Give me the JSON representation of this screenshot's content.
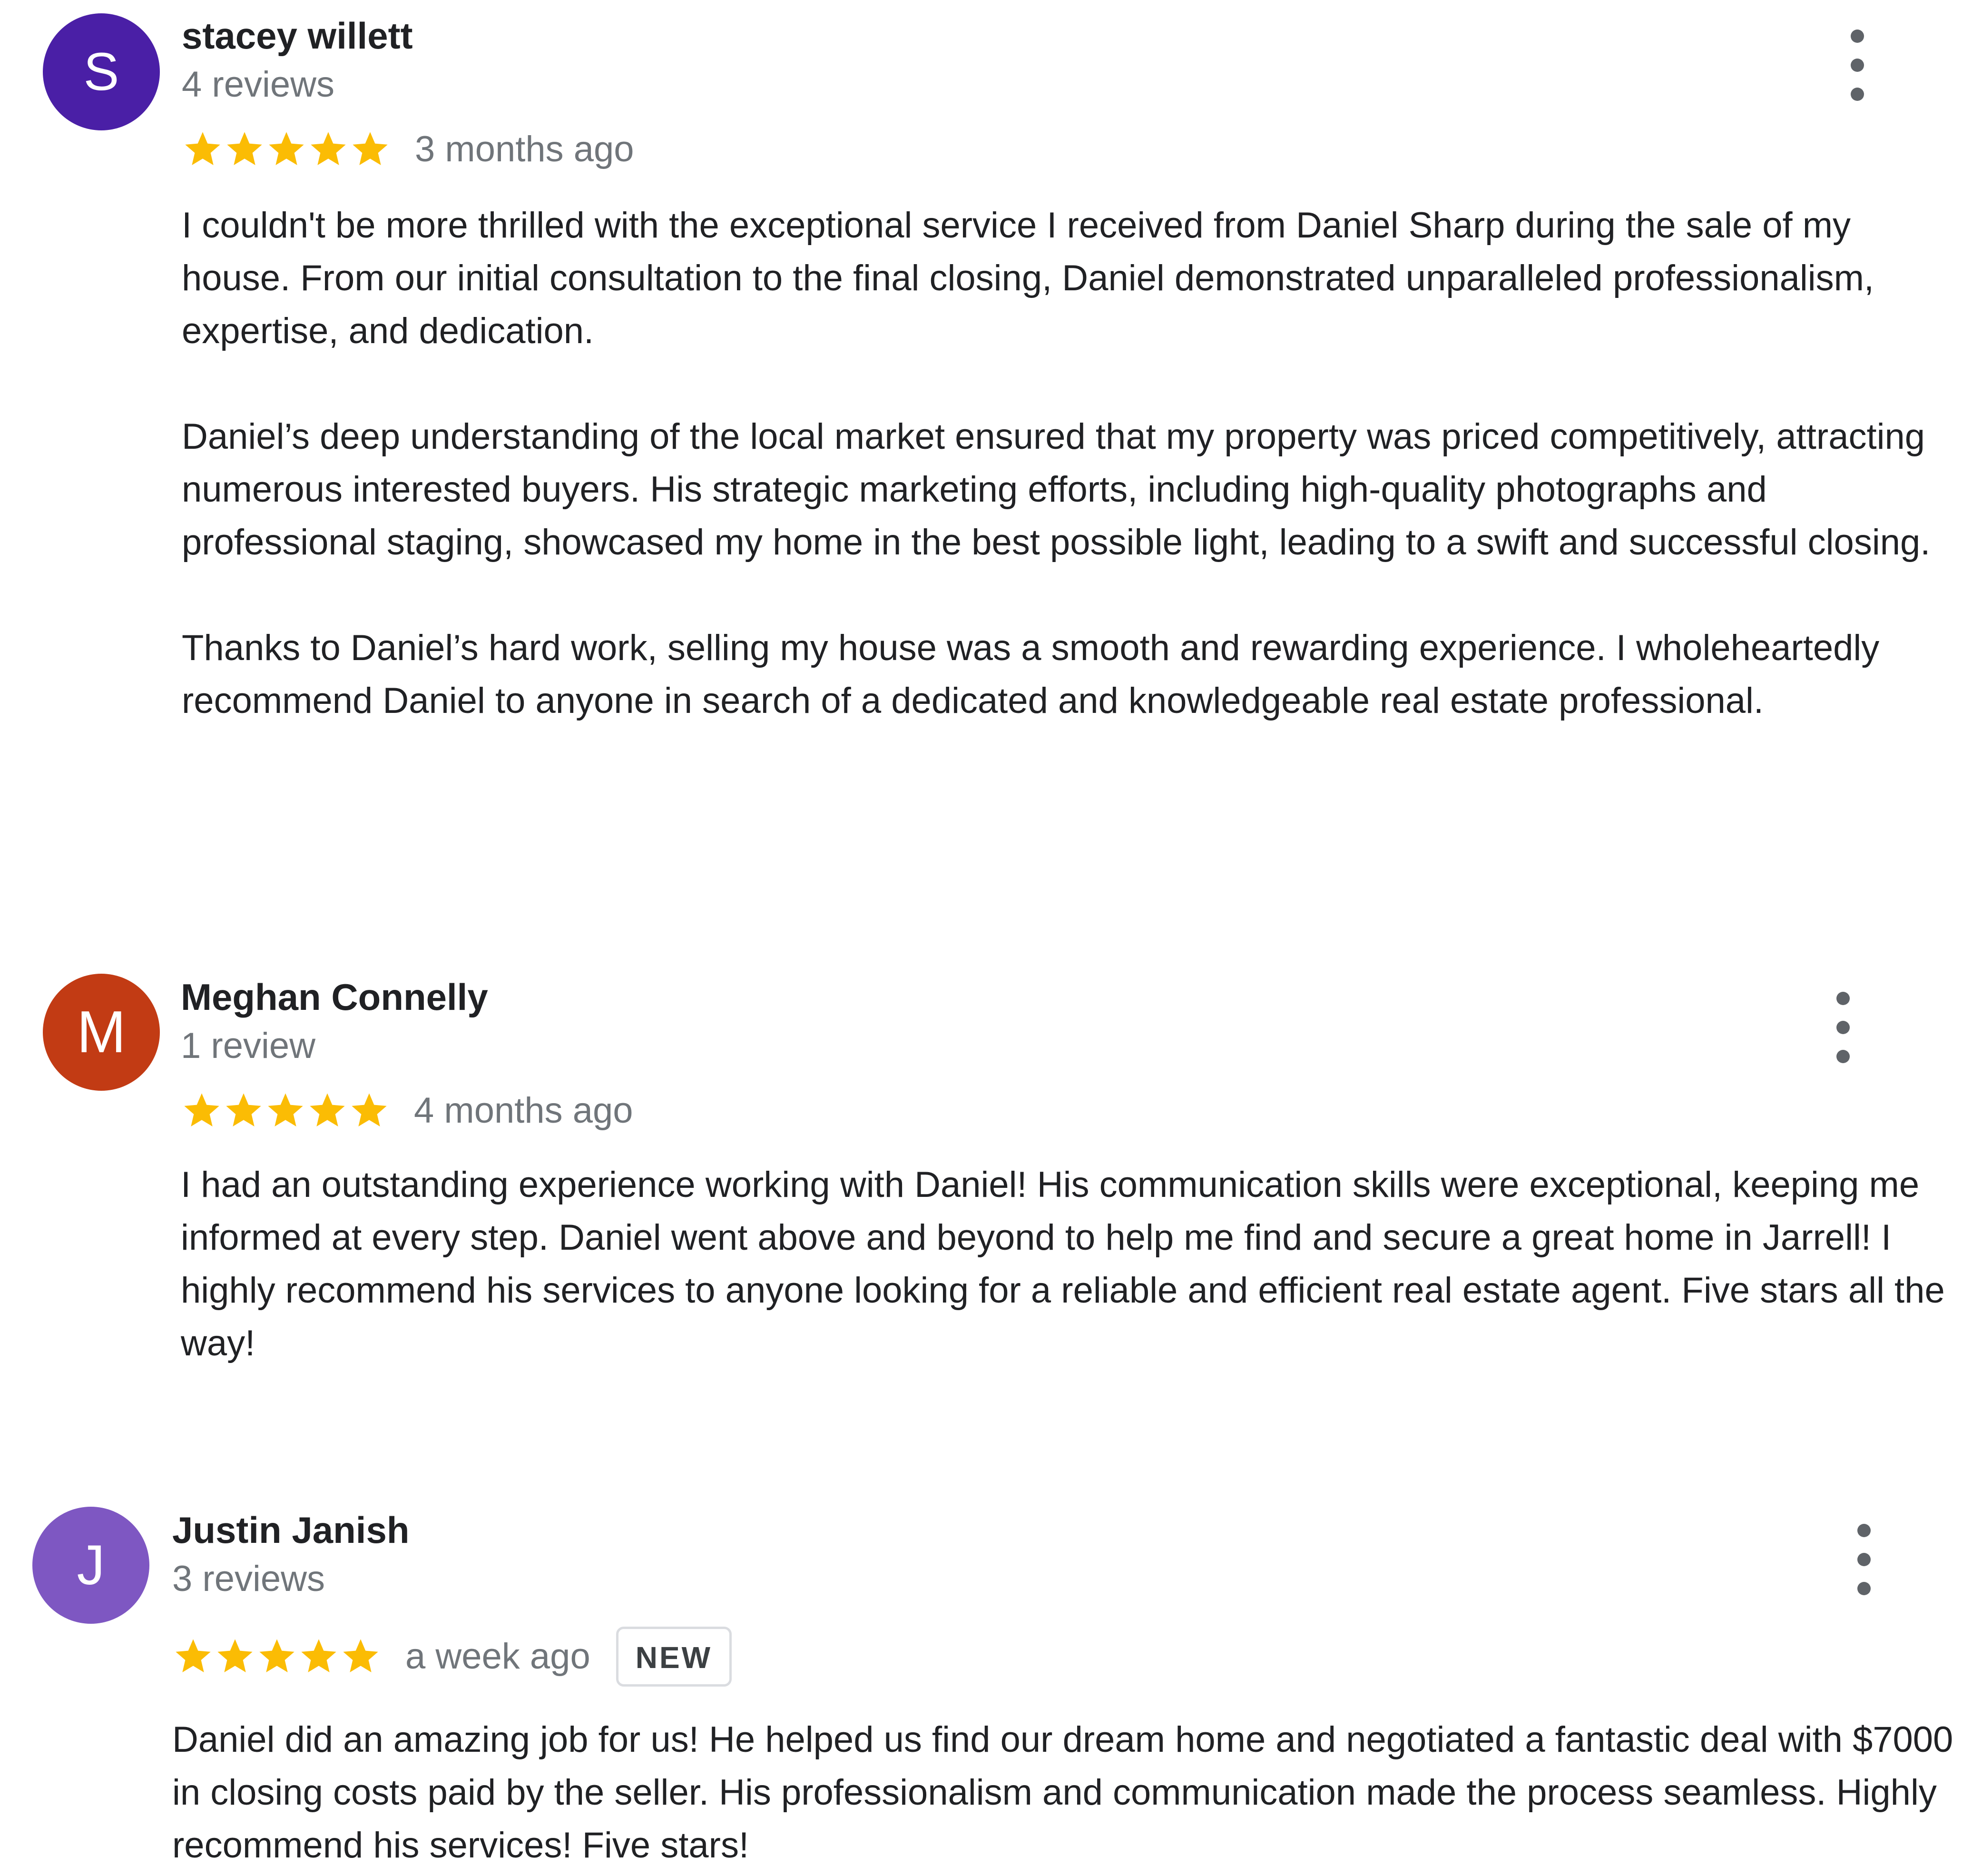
{
  "reviews": [
    {
      "avatar_letter": "S",
      "avatar_color": "#4a1fa6",
      "name": "stacey willett",
      "review_count": "4 reviews",
      "rating": 5,
      "time": "3 months ago",
      "paragraphs": [
        "I couldn't be more thrilled with the exceptional service I received from Daniel Sharp during the sale of my house. From our initial consultation to the final closing, Daniel demonstrated unparalleled professionalism, expertise, and dedication.",
        "Daniel’s deep understanding of the local market ensured that my property was priced competitively, attracting numerous interested buyers. His strategic marketing efforts, including high-quality photographs and professional staging, showcased my home in the best possible light, leading to a swift and successful closing.",
        "Thanks to Daniel’s hard work, selling my house was a smooth and rewarding experience. I wholeheartedly recommend Daniel to anyone in search of a dedicated and knowledgeable real estate professional."
      ]
    },
    {
      "avatar_letter": "M",
      "avatar_color": "#c23b14",
      "name": "Meghan Connelly",
      "review_count": "1 review",
      "rating": 5,
      "time": "4 months ago",
      "paragraphs": [
        "I had an outstanding experience working with Daniel! His communication skills were exceptional, keeping me informed at every step. Daniel went above and beyond to help me find and secure a great home in Jarrell! I highly recommend his services to anyone looking for a reliable and efficient real estate agent. Five stars all the way!"
      ]
    },
    {
      "avatar_letter": "J",
      "avatar_color": "#7e57c2",
      "name": "Justin Janish",
      "review_count": "3 reviews",
      "rating": 5,
      "time": "a week ago",
      "badge": "NEW",
      "paragraphs": [
        "Daniel did an amazing job for us! He helped us find our dream home and negotiated a fantastic deal with $7000 in closing costs paid by the seller. His professionalism and communication made the process seamless. Highly recommend his services! Five stars!"
      ]
    }
  ],
  "icons": {
    "star": "star-icon",
    "menu": "more-vert-icon"
  },
  "colors": {
    "star": "#fbbc04",
    "secondary_text": "#70757a"
  }
}
